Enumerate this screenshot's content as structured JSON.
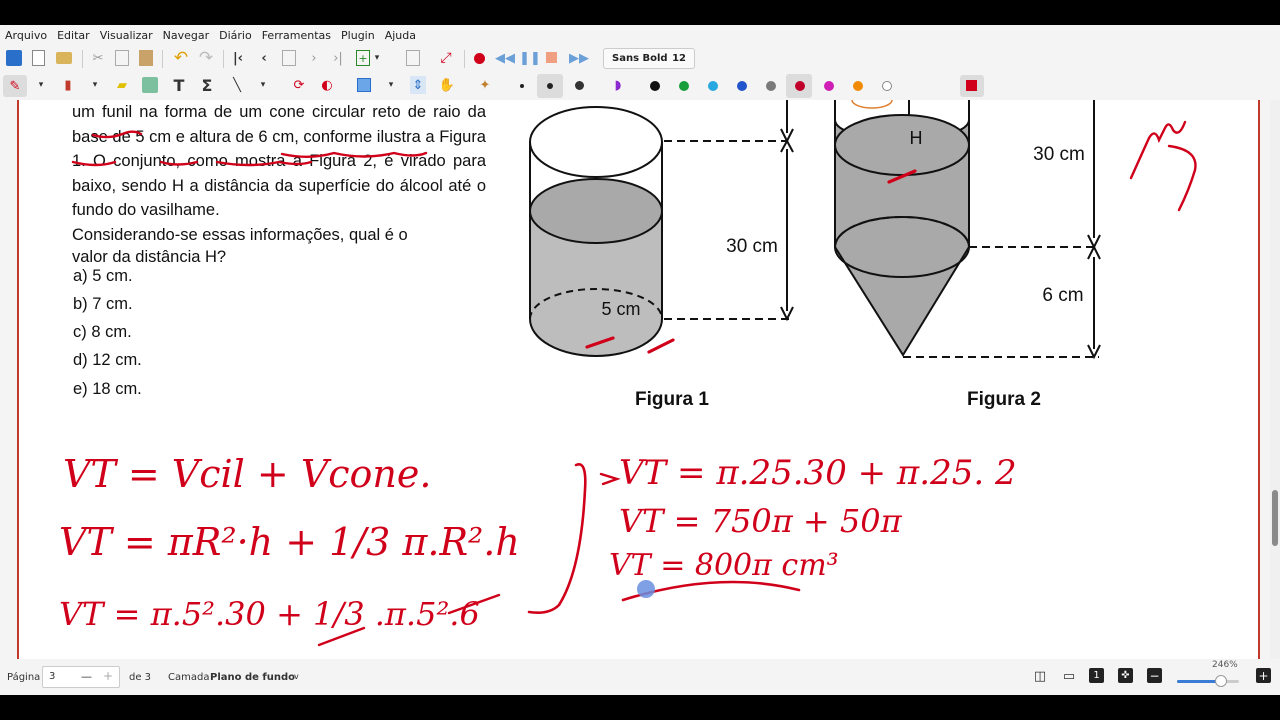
{
  "menu": [
    "Arquivo",
    "Editar",
    "Visualizar",
    "Navegar",
    "Diário",
    "Ferramentas",
    "Plugin",
    "Ajuda"
  ],
  "toolbar": {
    "font_name": "Sans Bold",
    "font_size": "12"
  },
  "colors": {
    "palette": [
      "#111111",
      "#1a9e3a",
      "#28a8e0",
      "#2255cc",
      "#7a7a7a",
      "#c0002a",
      "#d01fb5",
      "#f08a00",
      "#ffffff"
    ],
    "selected": "#c0002a",
    "ink": "#d0001a"
  },
  "question": {
    "text": "um funil na forma de um cone circular reto de raio da base de 5 cm e altura de 6 cm, conforme ilustra a Figura 1. O conjunto, como mostra a Figura 2, é virado para baixo, sendo H a distância da superfície do álcool até o fundo do vasilhame.",
    "prompt_line1": "Considerando-se essas informações, qual é o",
    "prompt_line2": "valor da distância H?",
    "options": [
      "a) 5 cm.",
      "b) 7 cm.",
      "c) 8 cm.",
      "d) 12 cm.",
      "e) 18 cm."
    ]
  },
  "figures": {
    "fig1_caption": "Figura 1",
    "fig2_caption": "Figura 2",
    "fig1_height": "30 cm",
    "fig1_radius": "5 cm",
    "fig2_height_cyl": "30 cm",
    "fig2_height_cone": "6 cm",
    "fig2_h": "H"
  },
  "handwriting": {
    "line1": "VT = Vcil + Vcone.",
    "line2": "VT = πR²·h + 1/3 π.R².h",
    "line3": "VT = π.5².30 + 1/3 .π.5².6",
    "line4": "VT = π.25.30 + π.25. 2",
    "line5": "VT = 750π + 50π",
    "line6": "VT = 800π cm³"
  },
  "status": {
    "page_label": "Página",
    "page_value": "3",
    "of_label": "de 3",
    "layer_label": "Camada",
    "layer_value": "Plano de fundo",
    "zoom": "246%"
  }
}
